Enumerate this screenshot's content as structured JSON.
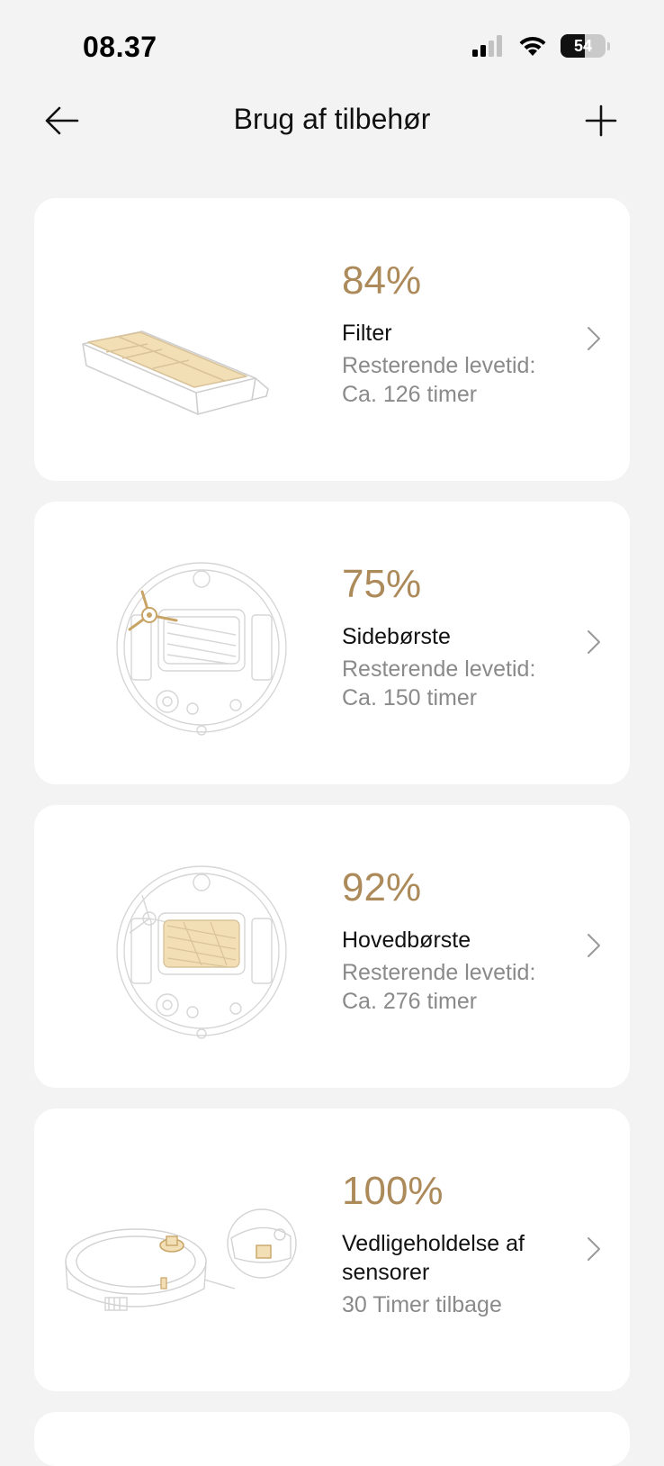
{
  "status_bar": {
    "time": "08.37",
    "battery_label": "54",
    "battery_level": 0.54
  },
  "nav": {
    "title": "Brug af tilbehør"
  },
  "accessories": [
    {
      "percent": "84%",
      "name": "Filter",
      "detail_line1": "Resterende levetid:",
      "detail_line2": "Ca. 126 timer",
      "illustration": "filter-illustration"
    },
    {
      "percent": "75%",
      "name": "Sidebørste",
      "detail_line1": "Resterende levetid:",
      "detail_line2": "Ca. 150 timer",
      "illustration": "side-brush-illustration"
    },
    {
      "percent": "92%",
      "name": "Hovedbørste",
      "detail_line1": "Resterende levetid:",
      "detail_line2": "Ca. 276 timer",
      "illustration": "main-brush-illustration"
    },
    {
      "percent": "100%",
      "name": "Vedligeholdelse af sensorer",
      "detail_line1": "30 Timer tilbage",
      "illustration": "sensor-maintenance-illustration"
    }
  ],
  "colors": {
    "accent": "#ac8a5a",
    "highlight_fill": "#f3dfb5",
    "background": "#f3f3f3",
    "card": "#ffffff",
    "muted_text": "#8a8a8a"
  }
}
